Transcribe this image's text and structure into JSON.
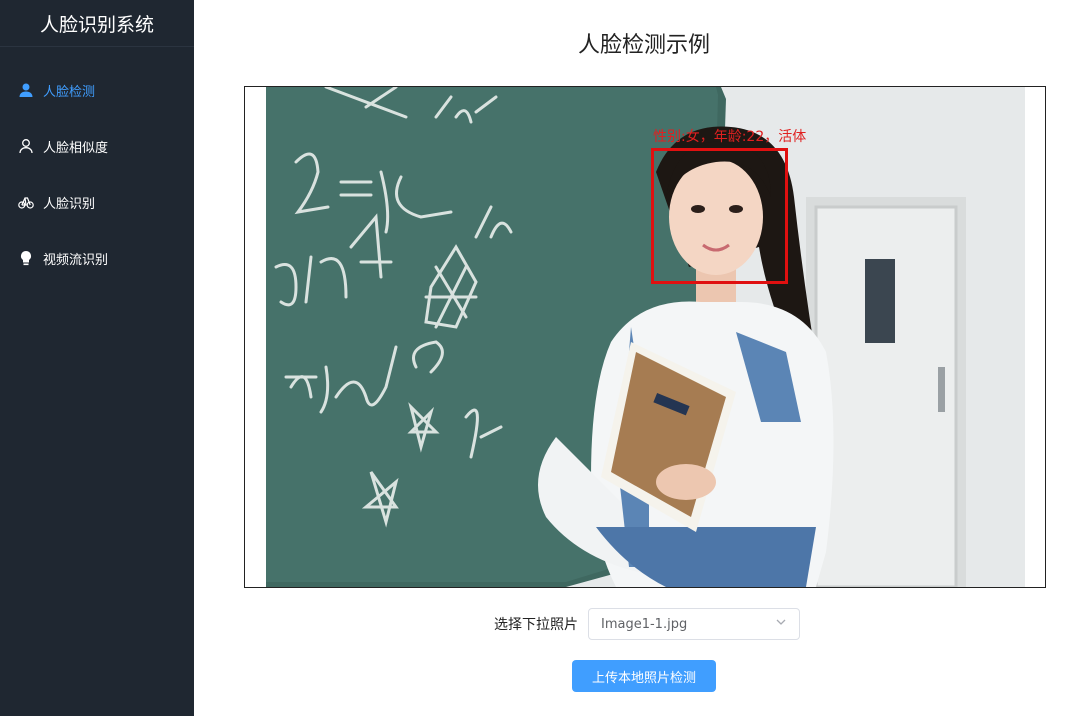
{
  "app": {
    "title": "人脸识别系统"
  },
  "sidebar": {
    "items": [
      {
        "label": "人脸检测",
        "icon": "user-solid-icon",
        "active": true
      },
      {
        "label": "人脸相似度",
        "icon": "user-outline-icon",
        "active": false
      },
      {
        "label": "人脸识别",
        "icon": "bicycle-icon",
        "active": false
      },
      {
        "label": "视频流识别",
        "icon": "lightbulb-icon",
        "active": false
      }
    ]
  },
  "main": {
    "title": "人脸检测示例",
    "detection": {
      "label": "性别:女，年龄:22，活体"
    },
    "select": {
      "label": "选择下拉照片",
      "value": "Image1-1.jpg"
    },
    "upload_button": "上传本地照片检测"
  },
  "colors": {
    "sidebar_bg": "#1f2731",
    "active": "#409eff",
    "detection": "#e01010",
    "button": "#409eff"
  }
}
